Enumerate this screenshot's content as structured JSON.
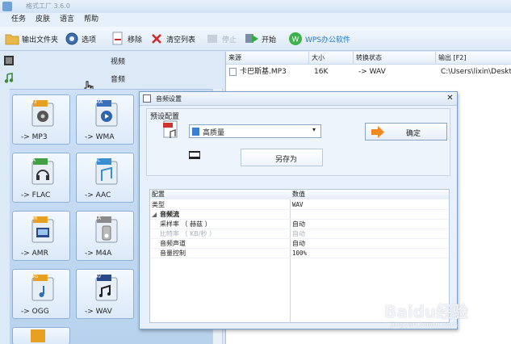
{
  "window": {
    "title": "格式工厂 3.6.0"
  },
  "menu": [
    "任务",
    "皮肤",
    "语言",
    "帮助"
  ],
  "toolbar": {
    "output_folder": "输出文件夹",
    "options": "选项",
    "remove": "移除",
    "clear_list": "清空列表",
    "stop": "停止",
    "start": "开始",
    "wps": "WPS办公软件"
  },
  "categories": {
    "video": "视频",
    "audio": "音频"
  },
  "formats": [
    {
      "badge": "MP3",
      "label": "-> MP3"
    },
    {
      "badge": "WMA",
      "label": "-> WMA"
    },
    {
      "badge": "FLA",
      "label": "-> FLAC"
    },
    {
      "badge": "AAC",
      "label": "-> AAC"
    },
    {
      "badge": "AMR",
      "label": "-> AMR"
    },
    {
      "badge": "M4A",
      "label": "-> M4A"
    },
    {
      "badge": "OGG",
      "label": "-> OGG"
    },
    {
      "badge": "WAV",
      "label": "-> WAV"
    }
  ],
  "grid": {
    "headers": [
      "来源",
      "大小",
      "转换状态",
      "输出 [F2]"
    ],
    "rows": [
      {
        "source": "卡巴斯基.MP3",
        "size": "16K",
        "status": "-> WAV",
        "output": "C:\\Users\\lixin\\Deskt..."
      }
    ]
  },
  "dialog": {
    "title": "音频设置",
    "preset_label": "预设配置",
    "preset_value": "高质量",
    "ok": "确定",
    "save_as": "另存为",
    "table": {
      "headers": [
        "配置",
        "数值"
      ],
      "rows": [
        {
          "name": "类型",
          "value": "WAV"
        },
        {
          "name": "音频流",
          "value": ""
        },
        {
          "name": "采样率 （ 赫兹 ）",
          "value": "自动"
        },
        {
          "name": "比特率 （ KB/秒 ）",
          "value": "自动"
        },
        {
          "name": "音频声道",
          "value": "自动"
        },
        {
          "name": "音量控制",
          "value": "100%"
        }
      ]
    }
  },
  "watermark": {
    "brand": "Baidu经验",
    "url": "jingyan.baidu.com"
  },
  "colors": {
    "accent": "#1e78c8",
    "panel": "#dce9f7",
    "dialog": "#e8f1fb"
  }
}
